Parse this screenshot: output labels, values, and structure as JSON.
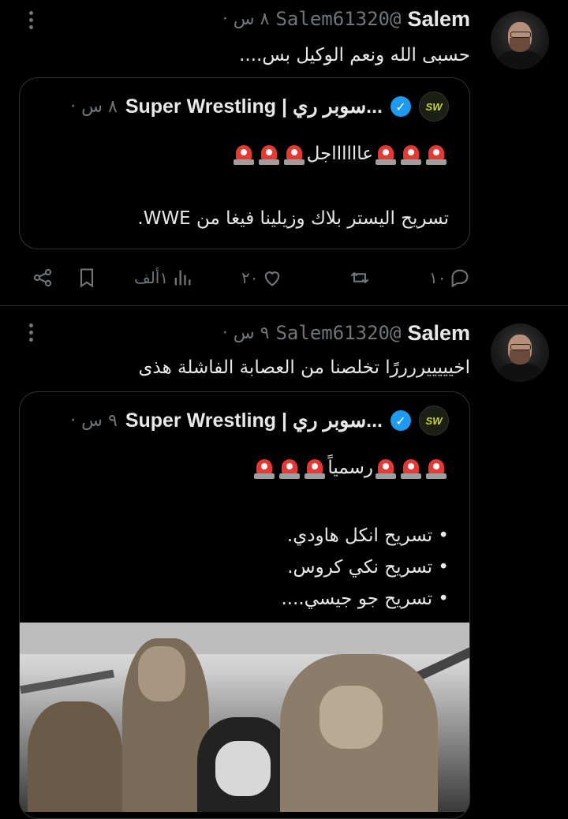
{
  "tweets": [
    {
      "name": "Salem",
      "handle": "@Salem61320",
      "time": "٨ س ·",
      "text": "حسبى الله ونعم الوكيل بس....",
      "quote": {
        "account": "...سوبر ري | Super Wrestling",
        "logo": "SW",
        "time": "٨ س ·",
        "line1": "عااااااجل",
        "line2": "تسريح اليستر بلاك وزيلينا فيغا من WWE."
      },
      "stats": {
        "replies": "١٠",
        "retweets": "",
        "likes": "٢٠",
        "views": "١ألف"
      }
    },
    {
      "name": "Salem",
      "handle": "@Salem61320",
      "time": "٩ س ·",
      "text": "اخيييييررررًا تخلصنا من العصابة الفاشلة هذى",
      "quote": {
        "account": "...سوبر ري | Super Wrestling",
        "logo": "SW",
        "time": "٩ س ·",
        "line1": "رسمياً",
        "bullets": [
          "• تسريح انكل هاودي.",
          "• تسريح نكي كروس.",
          "• تسريح جو جيسي...."
        ]
      }
    }
  ],
  "icons": {
    "more": "more-icon",
    "verified": "verified-badge-icon",
    "siren": "police-light-icon",
    "reply": "reply-icon",
    "retweet": "retweet-icon",
    "like": "heart-icon",
    "views": "views-chart-icon",
    "bookmark": "bookmark-icon",
    "share": "share-icon"
  },
  "colors": {
    "background": "#000000",
    "text": "#e7e9ea",
    "muted": "#71767b",
    "verified": "#1d9bf0",
    "siren": "#e53935"
  }
}
